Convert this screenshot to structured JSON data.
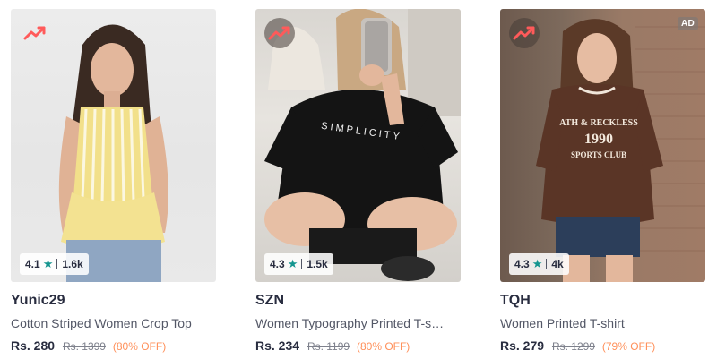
{
  "products": [
    {
      "brand": "Yunic29",
      "name": "Cotton Striped Women Crop Top",
      "price": "Rs. 280",
      "mrp": "Rs. 1399",
      "discount": "(80% OFF)",
      "rating": "4.1",
      "rating_count": "1.6k",
      "trending_icon": "trending-up-icon"
    },
    {
      "brand": "SZN",
      "name": "Women Typography Printed T-shirt",
      "price": "Rs. 234",
      "mrp": "Rs. 1199",
      "discount": "(80% OFF)",
      "rating": "4.3",
      "rating_count": "1.5k",
      "trending_icon": "trending-up-icon",
      "tshirt_print": "SIMPLICITY"
    },
    {
      "brand": "TQH",
      "name": "Women Printed T-shirt",
      "price": "Rs. 279",
      "mrp": "Rs. 1299",
      "discount": "(79% OFF)",
      "rating": "4.3",
      "rating_count": "4k",
      "trending_icon": "trending-up-icon",
      "ad_label": "AD",
      "tshirt_print": [
        "ATH & RECKLESS",
        "1990",
        "SPORTS CLUB"
      ]
    }
  ],
  "colors": {
    "trending_accent": "#ff5a5a",
    "rating_star": "#14958f",
    "discount": "#ff905a"
  }
}
